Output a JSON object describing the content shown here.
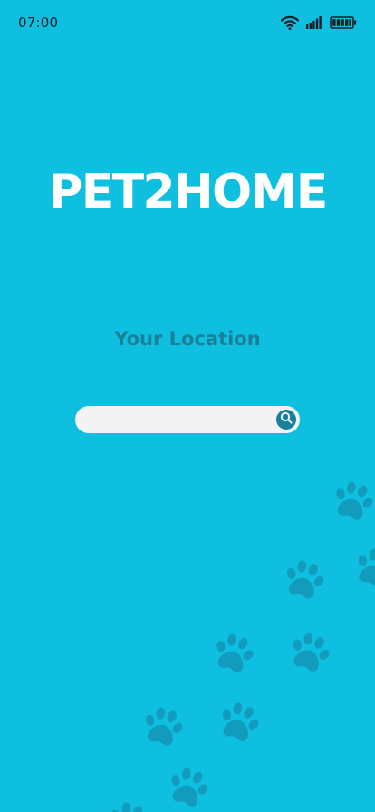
{
  "status_bar": {
    "time": "07:00",
    "icons": [
      "wifi-icon",
      "signal-icon",
      "battery-icon"
    ]
  },
  "app": {
    "title": "PET2HOME"
  },
  "location": {
    "label": "Your Location"
  },
  "search": {
    "value": "",
    "placeholder": "",
    "button_icon": "search-icon"
  },
  "decoration": {
    "icon": "paw-print-icon"
  },
  "colors": {
    "background": "#0fbfe0",
    "title": "#ffffff",
    "label": "#1a7f98",
    "search_field": "#f3f3f4",
    "search_button": "#17809b",
    "paw": "#139bbe"
  }
}
